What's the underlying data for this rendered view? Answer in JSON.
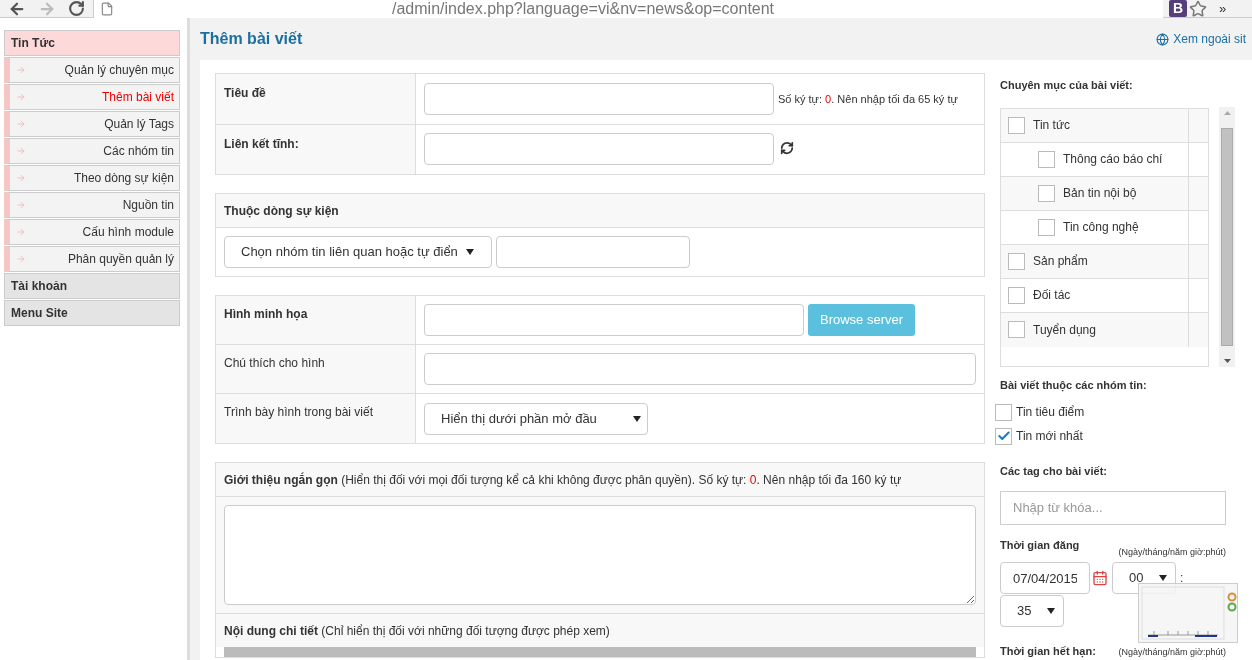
{
  "browser": {
    "url": "/admin/index.php?language=vi&nv=news&op=content",
    "extension_label": "B",
    "overflow": "»"
  },
  "sidebar": {
    "sections": [
      {
        "label": "Tin Tức",
        "expanded": true,
        "items": [
          {
            "label": "Quản lý chuyên mục",
            "selected": false
          },
          {
            "label": "Thêm bài viết",
            "selected": true
          },
          {
            "label": "Quản lý Tags",
            "selected": false
          },
          {
            "label": "Các nhóm tin",
            "selected": false
          },
          {
            "label": "Theo dòng sự kiện",
            "selected": false
          },
          {
            "label": "Nguồn tin",
            "selected": false
          },
          {
            "label": "Cấu hình module",
            "selected": false
          },
          {
            "label": "Phân quyền quản lý",
            "selected": false
          }
        ]
      },
      {
        "label": "Tài khoản",
        "expanded": false
      },
      {
        "label": "Menu Site",
        "expanded": false
      }
    ]
  },
  "page": {
    "title": "Thêm bài viết",
    "view_site_link": "Xem ngoài sit"
  },
  "title_row": {
    "label": "Tiêu đề",
    "counter_prefix": "Số ký tự: ",
    "count": "0",
    "counter_suffix": ". Nên nhập tối đa 65 ký tự"
  },
  "link_row": {
    "label": "Liên kết tĩnh:"
  },
  "event_panel": {
    "heading": "Thuộc dòng sự kiện",
    "select_value": "Chọn nhóm tin liên quan hoặc tự điển"
  },
  "image_panel": {
    "rows": [
      {
        "kind": "browse",
        "label": "Hình minh họa",
        "button": "Browse server"
      },
      {
        "kind": "text",
        "label": "Chú thích cho hình"
      },
      {
        "kind": "select",
        "label": "Trình bày hình trong bài viết",
        "value": "Hiển thị dưới phần mở đầu"
      }
    ]
  },
  "intro_panel": {
    "heading": "**Giới thiệu ngắn gọn** (Hiển thị đối với mọi đối tượng kể cả khi không được phân quyền). Số ký tự: ",
    "count": "0",
    "suffix": ". Nên nhập tối đa 160 ký tự"
  },
  "content_panel": {
    "heading": "**Nội dung chi tiết** (Chỉ hiển thị đối với những đối tượng được phép xem)"
  },
  "categories": {
    "heading": "Chuyên mục của bài viết:",
    "items": [
      {
        "label": "Tin tức",
        "checked": false,
        "children": [
          {
            "label": "Thông cáo báo chí",
            "checked": false
          },
          {
            "label": "Bản tin nội bộ",
            "checked": false
          },
          {
            "label": "Tin công nghệ",
            "checked": false
          }
        ]
      },
      {
        "label": "Sản phẩm",
        "checked": false
      },
      {
        "label": "Đối tác",
        "checked": false
      },
      {
        "label": "Tuyển dụng",
        "checked": false
      }
    ]
  },
  "groups": {
    "heading": "Bài viết thuộc các nhóm tin:",
    "items": [
      {
        "label": "Tin tiêu điểm",
        "checked": false
      },
      {
        "label": "Tin mới nhất",
        "checked": true
      }
    ]
  },
  "tags": {
    "heading": "Các tag cho bài viết:",
    "placeholder": "Nhập từ khóa..."
  },
  "publish": {
    "heading": "Thời gian đăng",
    "hint": "(Ngày/tháng/năm giờ:phút)",
    "date": "07/04/2015",
    "hour": "00",
    "separator": ":",
    "minute": "35"
  },
  "expire": {
    "heading": "Thời gian hết hạn:",
    "hint": "(Ngày/tháng/năm giờ:phút)"
  }
}
